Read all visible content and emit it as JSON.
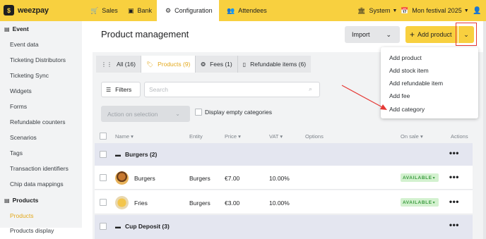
{
  "brand": {
    "logo_text": "weezpay"
  },
  "topnav": {
    "tabs": [
      {
        "label": "Sales",
        "icon": "cart-icon"
      },
      {
        "label": "Bank",
        "icon": "banknote-icon"
      },
      {
        "label": "Configuration",
        "icon": "gear-icon",
        "active": true
      },
      {
        "label": "Attendees",
        "icon": "users-icon"
      }
    ],
    "system_label": "System",
    "event_label": "Mon festival 2025",
    "user_icon": "user-icon"
  },
  "sidebar": {
    "sections": [
      {
        "title": "Event",
        "icon": "calendar-icon",
        "items": [
          "Event data",
          "Ticketing Distributors",
          "Ticketing Sync",
          "Widgets",
          "Forms",
          "Refundable counters",
          "Scenarios",
          "Tags",
          "Transaction identifiers",
          "Chip data mappings"
        ]
      },
      {
        "title": "Products",
        "icon": "box-icon",
        "items": [
          "Products",
          "Products display"
        ]
      }
    ],
    "active_item": "Products"
  },
  "page": {
    "title": "Product management",
    "import_label": "Import",
    "add_product_label": "Add product"
  },
  "tabs": [
    {
      "label": "All (16)",
      "icon": "grid-icon"
    },
    {
      "label": "Products (9)",
      "icon": "tag-icon",
      "active": true
    },
    {
      "label": "Fees (1)",
      "icon": "coins-icon"
    },
    {
      "label": "Refundable items (6)",
      "icon": "bottle-icon"
    }
  ],
  "toolbar": {
    "filters_label": "Filters",
    "search_placeholder": "Search",
    "action_label": "Action on selection",
    "empty_categories_label": "Display empty categories"
  },
  "table": {
    "columns": [
      "Name",
      "Entity",
      "Price",
      "VAT",
      "Options",
      "On sale",
      "Actions"
    ],
    "sortable": [
      "Name",
      "Price",
      "VAT",
      "On sale"
    ],
    "groups": [
      {
        "label": "Burgers (2)",
        "rows": [
          {
            "name": "Burgers",
            "entity": "Burgers",
            "price": "€7.00",
            "vat": "10.00%",
            "status": "AVAILABLE"
          },
          {
            "name": "Fries",
            "entity": "Burgers",
            "price": "€3.00",
            "vat": "10.00%",
            "status": "AVAILABLE"
          }
        ]
      },
      {
        "label": "Cup Deposit (3)",
        "rows": []
      }
    ]
  },
  "dropdown": {
    "items": [
      "Add product",
      "Add stock item",
      "Add refundable item",
      "Add fee",
      "Add category"
    ]
  },
  "colors": {
    "accent": "#f8d03f",
    "active_text": "#e3a81b",
    "highlight": "#e53935",
    "available_bg": "#d3f1cf",
    "available_text": "#3a9b3f"
  }
}
